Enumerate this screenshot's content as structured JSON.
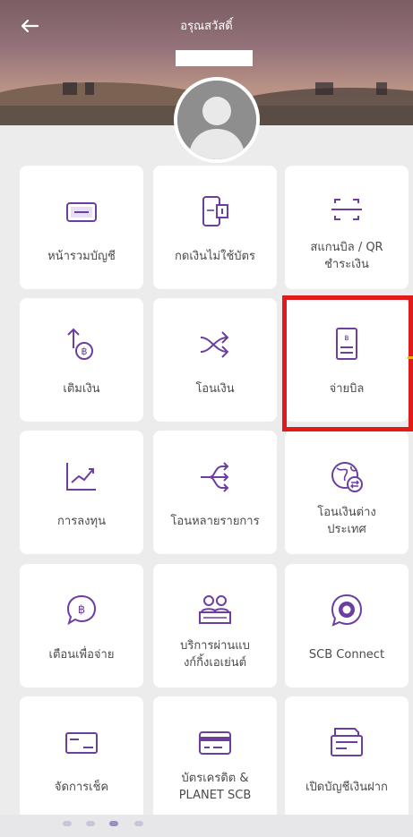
{
  "header": {
    "greeting": "อรุณสวัสดิ์",
    "back": "←"
  },
  "colors": {
    "purple": "#6b3fa0",
    "highlight": "#e01b1b"
  },
  "tiles": [
    {
      "label_1": "หน้ารวมบัญชี",
      "label_2": "",
      "icon": "account-card-icon"
    },
    {
      "label_1": "กดเงินไม่ใช้บัตร",
      "label_2": "",
      "icon": "phone-atm-icon"
    },
    {
      "label_1": "สแกนบิล / QR",
      "label_2": "ชำระเงิน",
      "icon": "scan-icon"
    },
    {
      "label_1": "เติมเงิน",
      "label_2": "",
      "icon": "topup-baht-icon"
    },
    {
      "label_1": "โอนเงิน",
      "label_2": "",
      "icon": "transfer-icon"
    },
    {
      "label_1": "จ่ายบิล",
      "label_2": "",
      "icon": "bill-icon"
    },
    {
      "label_1": "การลงทุน",
      "label_2": "",
      "icon": "investment-chart-icon"
    },
    {
      "label_1": "โอนหลายรายการ",
      "label_2": "",
      "icon": "multi-transfer-icon"
    },
    {
      "label_1": "โอนเงินต่าง",
      "label_2": "ประเทศ",
      "icon": "globe-transfer-icon"
    },
    {
      "label_1": "เตือนเพื่อจ่าย",
      "label_2": "",
      "icon": "reminder-baht-icon"
    },
    {
      "label_1": "บริการผ่านแบ",
      "label_2": "งก์กิ้งเอเย่นต์",
      "icon": "agent-service-icon"
    },
    {
      "label_1": "SCB Connect",
      "label_2": "",
      "icon": "scb-connect-icon"
    },
    {
      "label_1": "จัดการเช็ค",
      "label_2": "",
      "icon": "cheque-icon"
    },
    {
      "label_1": "บัตรเครดิต &",
      "label_2": "PLANET SCB",
      "icon": "credit-card-icon"
    },
    {
      "label_1": "เปิดบัญชีเงินฝาก",
      "label_2": "",
      "icon": "open-account-icon"
    }
  ]
}
